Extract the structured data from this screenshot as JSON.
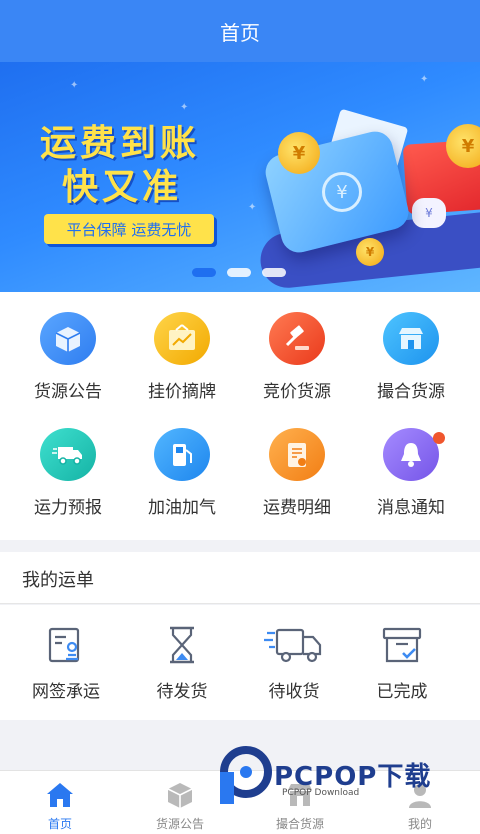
{
  "app": {
    "title": "首页"
  },
  "banner": {
    "headline_line1": "运费到账",
    "headline_line2": "快又准",
    "tagline": "平台保障 运费无忧",
    "currency_symbol": "¥",
    "active_slide": 1,
    "slide_count": 3
  },
  "grid": [
    {
      "label": "货源公告",
      "icon": "box-icon",
      "color": "#3d8bf2"
    },
    {
      "label": "挂价摘牌",
      "icon": "price-board-icon",
      "color": "#f7b400"
    },
    {
      "label": "竞价货源",
      "icon": "auction-hammer-icon",
      "color": "#f2552b"
    },
    {
      "label": "撮合货源",
      "icon": "store-icon",
      "color": "#2aa8f2"
    },
    {
      "label": "运力预报",
      "icon": "truck-icon",
      "color": "#24c6b8"
    },
    {
      "label": "加油加气",
      "icon": "fuel-pump-icon",
      "color": "#2f9df4"
    },
    {
      "label": "运费明细",
      "icon": "bill-icon",
      "color": "#f59b2a"
    },
    {
      "label": "消息通知",
      "icon": "bell-icon",
      "color": "#8a6af0"
    }
  ],
  "orders": {
    "title": "我的运单",
    "items": [
      {
        "label": "网签承运",
        "icon": "contract-icon"
      },
      {
        "label": "待发货",
        "icon": "hourglass-icon"
      },
      {
        "label": "待收货",
        "icon": "delivery-truck-icon"
      },
      {
        "label": "已完成",
        "icon": "completed-box-icon"
      }
    ]
  },
  "tabbar": [
    {
      "label": "首页",
      "icon": "home-icon",
      "active": true
    },
    {
      "label": "货源公告",
      "icon": "cube-icon",
      "active": false
    },
    {
      "label": "撮合货源",
      "icon": "store-tab-icon",
      "active": false
    },
    {
      "label": "我的",
      "icon": "user-icon",
      "active": false
    }
  ],
  "watermark": {
    "brand": "PCPOP下载",
    "sub": "PCPOP Download"
  },
  "colors": {
    "primary": "#3a86f5",
    "banner_yellow": "#ffe24a",
    "badge": "#f0562d"
  }
}
